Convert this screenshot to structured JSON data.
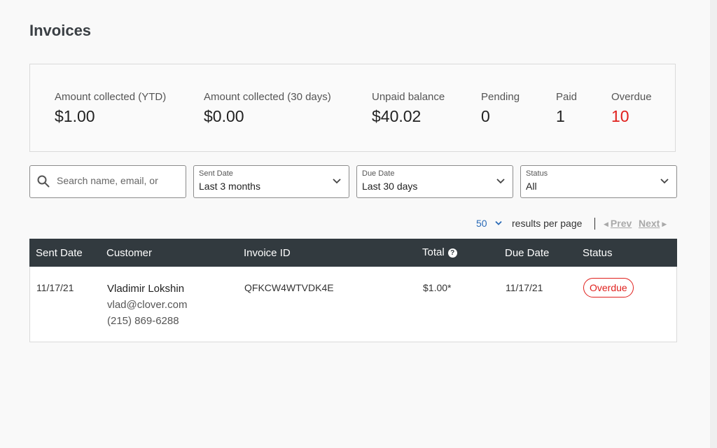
{
  "page": {
    "title": "Invoices"
  },
  "summary": {
    "ytd_label": "Amount collected (YTD)",
    "ytd_value": "$1.00",
    "d30_label": "Amount collected (30 days)",
    "d30_value": "$0.00",
    "unpaid_label": "Unpaid balance",
    "unpaid_value": "$40.02",
    "pending_label": "Pending",
    "pending_value": "0",
    "paid_label": "Paid",
    "paid_value": "1",
    "overdue_label": "Overdue",
    "overdue_value": "10",
    "overdue_color": "#e0201d"
  },
  "filters": {
    "search_placeholder": "Search name, email, or",
    "search_value": "",
    "sent_date": {
      "label": "Sent Date",
      "value": "Last 3 months"
    },
    "due_date": {
      "label": "Due Date",
      "value": "Last 30 days"
    },
    "status": {
      "label": "Status",
      "value": "All"
    }
  },
  "pagination": {
    "per_page": "50",
    "per_page_label": "results per page",
    "prev": "Prev",
    "next": "Next"
  },
  "table": {
    "columns": {
      "sent_date": "Sent Date",
      "customer": "Customer",
      "invoice_id": "Invoice ID",
      "total": "Total",
      "due_date": "Due Date",
      "status": "Status"
    },
    "rows": [
      {
        "sent_date": "11/17/21",
        "customer_name": "Vladimir Lokshin",
        "customer_email": "vlad@clover.com",
        "customer_phone": "(215) 869-6288",
        "invoice_id": "QFKCW4WTVDK4E",
        "total": "$1.00*",
        "due_date": "11/17/21",
        "status": "Overdue"
      }
    ]
  },
  "colors": {
    "header_bg": "#323a3f",
    "accent_blue": "#2a6ab6",
    "status_red": "#e0201d"
  }
}
